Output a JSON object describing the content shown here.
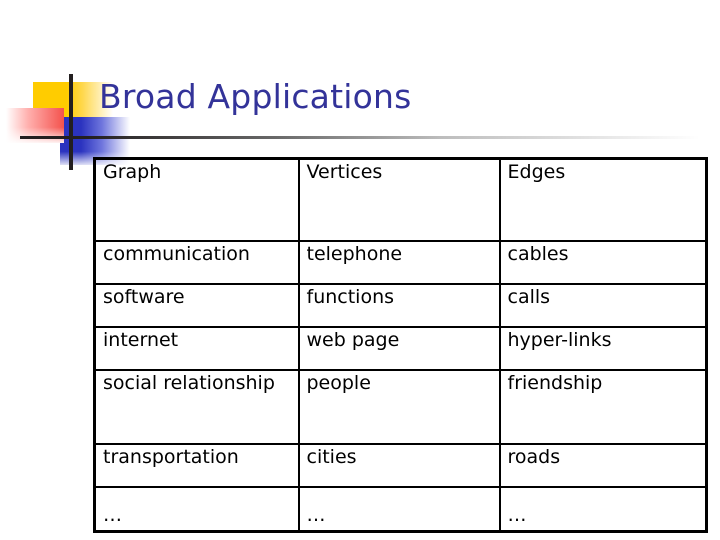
{
  "slide": {
    "title": "Broad Applications",
    "title_color": "#333399",
    "background_color": "#ffffff"
  },
  "decoration": {
    "yellow_swatch_color": "#ffcc00",
    "red_swatch_color": "#f4524d",
    "blue_swatch_color": "#2b33bf",
    "rule_color": "#231f20"
  },
  "table": {
    "columns": [
      "Graph",
      "Vertices",
      "Edges"
    ],
    "rows": [
      [
        "communication",
        "telephone",
        "cables"
      ],
      [
        "software",
        "functions",
        "calls"
      ],
      [
        "internet",
        "web page",
        "hyper-links"
      ],
      [
        "social relationship",
        "people",
        "friendship"
      ],
      [
        "transportation",
        "cities",
        "roads"
      ],
      [
        "…",
        "…",
        "…"
      ]
    ]
  }
}
